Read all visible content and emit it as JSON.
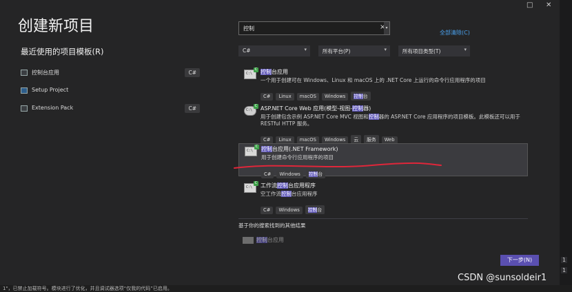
{
  "window": {
    "title": "创建新项目",
    "minimize": "□",
    "close": "✕"
  },
  "recent": {
    "heading": "最近使用的项目模板(R)",
    "items": [
      {
        "label": "控制台应用",
        "tag": "C#"
      },
      {
        "label": "Setup Project",
        "tag": ""
      },
      {
        "label": "Extension Pack",
        "tag": "C#"
      }
    ]
  },
  "search": {
    "value": "控制",
    "clear": "×",
    "clear_all": "全部清除(C)"
  },
  "filters": {
    "language": "C#",
    "platform": "所有平台(P)",
    "type": "所有项目类型(T)",
    "arrow": "▾"
  },
  "templates": [
    {
      "name_hl": "控制",
      "name_rest": "台应用",
      "desc_pre": "一个用于创建可在 Windows、Linux 和 macOS 上的 .NET Core 上运行的命令行应用程序的项目",
      "tags": [
        "C#",
        "Linux",
        "macOS",
        "Windows"
      ],
      "tag_hl_a": "控制",
      "tag_hl_b": "台"
    },
    {
      "name_pre": "ASP.NET Core Web 应用(模型-视图-",
      "name_hl": "控制",
      "name_rest": "器)",
      "desc_pre": "用于创建包含示例 ASP.NET Core MVC 视图和",
      "desc_hl": "控制",
      "desc_rest": "器的 ASP.NET Core 应用程序的项目模板。此模板还可以用于",
      "desc_line2": "RESTful HTTP 服务。",
      "tags": [
        "C#",
        "Linux",
        "macOS",
        "Windows",
        "云",
        "服务",
        "Web"
      ]
    },
    {
      "name_hl": "控制",
      "name_rest": "台应用(.NET Framework)",
      "desc_pre": "用于创建命令行应用程序的项目",
      "tags": [
        "C#",
        "Windows"
      ],
      "tag_hl_a": "控制",
      "tag_hl_b": "台"
    },
    {
      "name_pre": "工作流",
      "name_hl": "控制",
      "name_rest": "台应用程序",
      "desc_pre": "空工作流",
      "desc_hl": "控制",
      "desc_rest": "台应用程序",
      "tags": [
        "C#",
        "Windows"
      ],
      "tag_hl_a": "控制",
      "tag_hl_b": "台"
    }
  ],
  "others": {
    "heading": "基于你的搜索找到的其他结果",
    "item_hl": "控制",
    "item_rest": "台应用"
  },
  "next_button": "下一步(N)",
  "watermark": "CSDN @sunsoldeir1",
  "status_text": "1\"，已禁止加载符号。模块进行了优化，并且调试器选项“仅我的代码”已启用。",
  "right_strip": [
    "1",
    "1"
  ],
  "colors": {
    "accent": "#5a4fb0",
    "highlight": "#5c54b8",
    "scribble": "#e0263a",
    "link": "#4aa3f0"
  }
}
